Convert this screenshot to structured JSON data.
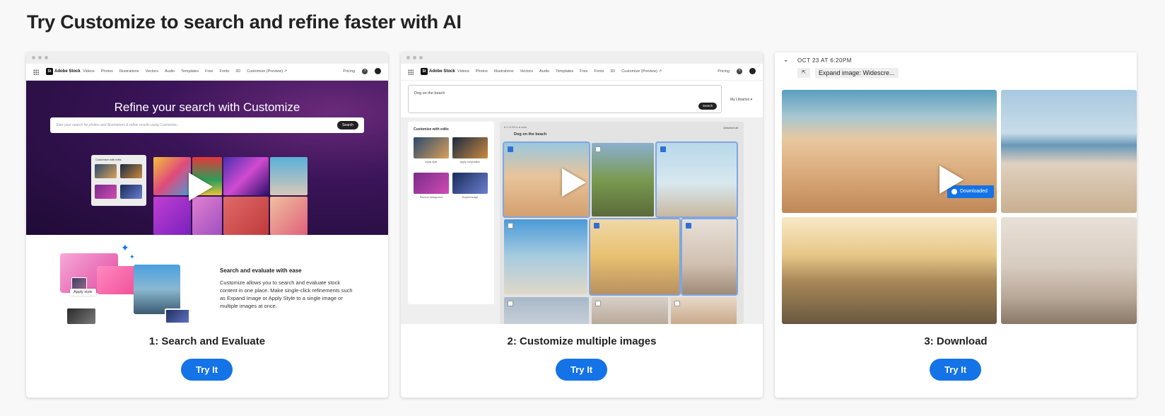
{
  "page": {
    "heading": "Try Customize to search and refine faster with AI"
  },
  "colors": {
    "accent": "#1473e6",
    "hero_dark": "#1f0b36",
    "hero_mid": "#3a1458"
  },
  "nav": {
    "logo_mark": "St",
    "logo_text": "Adobe Stock",
    "links": [
      "Videos",
      "Photos",
      "Illustrations",
      "Vectors",
      "Audio",
      "Templates",
      "Free",
      "Fonts",
      "3D",
      "Customize (Preview) ↗"
    ],
    "pricing": "Pricing",
    "help": "?"
  },
  "cards": [
    {
      "title": "1: Search and Evaluate",
      "button": "Try It",
      "hero_title": "Refine your search with Customize",
      "search_placeholder": "Start your search for photos and illustrations & refine results using Customize...",
      "search_button": "Search",
      "panel_title": "Customize with edits",
      "apply_chip": "Apply style",
      "feature_title": "Search and evaluate with ease",
      "feature_desc": "Customize allows you to search and evaluate stock content in one place. Make single-click refinements such as Expand Image or Apply Style to a single image or multiple images at once."
    },
    {
      "title": "2: Customize multiple images",
      "button": "Try It",
      "search_text": "Dog on the beach",
      "search_button": "Search",
      "libraries": "My Libraries ▾",
      "side_title": "Customize with edits",
      "side_labels": [
        "Apply style",
        "Apply composition",
        "Remove background",
        "Expand image"
      ],
      "results_meta": "▾  1 of 24 in a view",
      "results_title": "Dog on the beach",
      "deselect": "Deselect all"
    },
    {
      "title": "3: Download",
      "button": "Try It",
      "timestamp": "OCT 23 AT 6:20PM",
      "chip": "Expand image: Widescre...",
      "downloaded": "Downloaded"
    }
  ]
}
